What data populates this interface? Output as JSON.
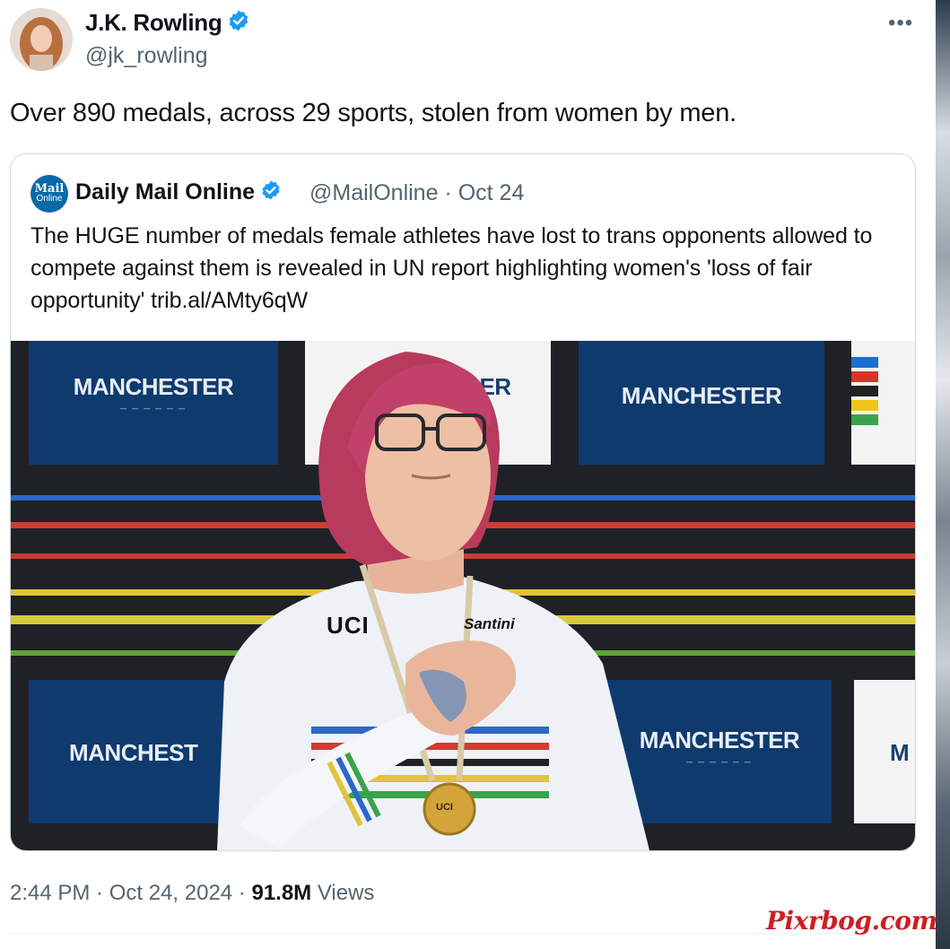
{
  "tweet": {
    "author_name": "J.K. Rowling",
    "author_handle": "@jk_rowling",
    "more_label": "•••",
    "text": "Over 890 medals, across 29 sports, stolen from women by men.",
    "timestamp": "2:44 PM · Oct 24, 2024 · ",
    "views_count": "91.8M",
    "views_label": " Views"
  },
  "quote": {
    "logo_line1": "Mail",
    "logo_line2": "Online",
    "source_name": "Daily Mail Online",
    "source_handle": "@MailOnline",
    "date": " · Oct 24",
    "text": "The HUGE number of medals female athletes have lost to trans opponents allowed to compete against them is revealed in UN report highlighting women's 'loss of fair opportunity' trib.al/AMty6qW"
  },
  "photo": {
    "board_text": "MANCHESTER",
    "board_partial": "MANCHEST",
    "board_partial_right": "ER",
    "board_edge": "M",
    "jersey_logo": "UCI",
    "jersey_sponsor": "Santini",
    "medal_text": "UCI"
  },
  "watermark": "Pixrbog.com",
  "colors": {
    "verified_blue": "#1d9bf0",
    "text_secondary": "#536471",
    "watermark_red": "#cc1e25"
  }
}
